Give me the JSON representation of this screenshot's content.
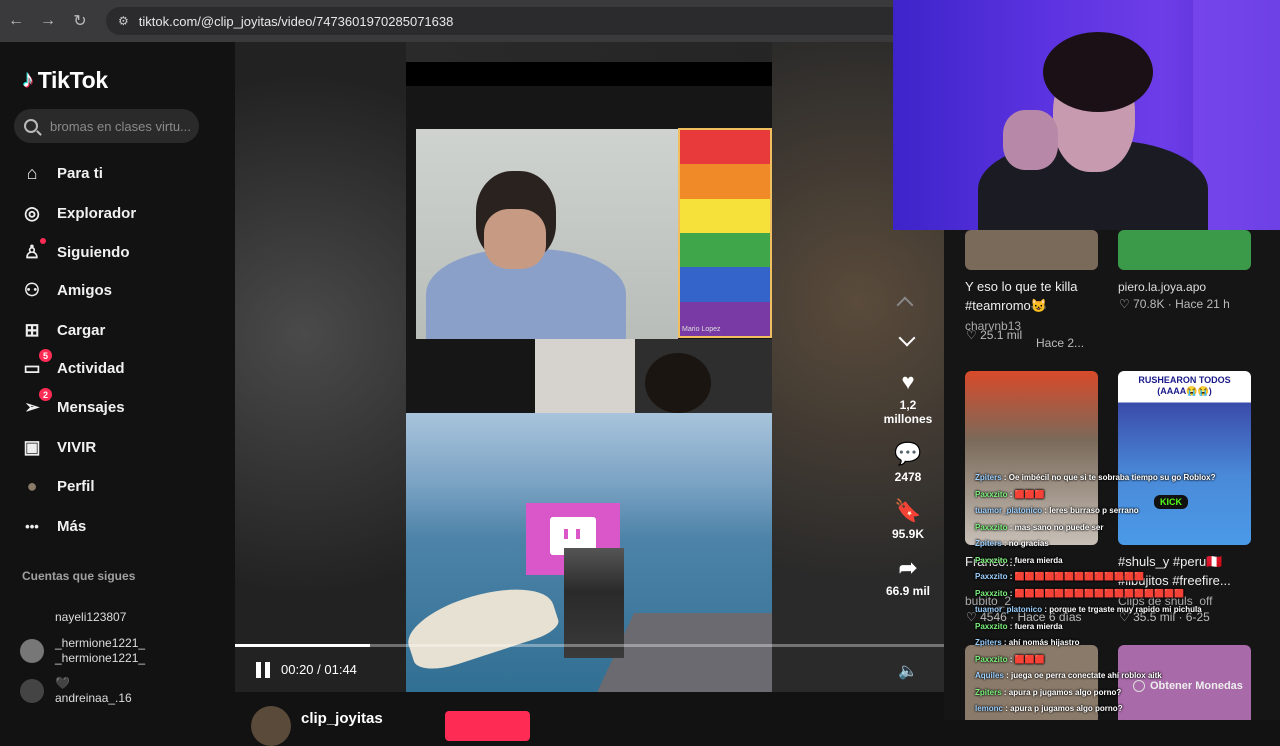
{
  "browser": {
    "url": "tiktok.com/@clip_joyitas/video/7473601970285071638",
    "back_icon": "←",
    "forward_icon": "→",
    "reload_icon": "↻",
    "site_icon": "⚙"
  },
  "sidebar": {
    "logo": "TikTok",
    "search_placeholder": "bromas en clases virtu...",
    "items": [
      {
        "label": "Para ti",
        "icon": "⌂"
      },
      {
        "label": "Explorador",
        "icon": "◎"
      },
      {
        "label": "Siguiendo",
        "icon": "♙"
      },
      {
        "label": "Amigos",
        "icon": "⚇"
      },
      {
        "label": "Cargar",
        "icon": "⊞"
      },
      {
        "label": "Actividad",
        "icon": "▭",
        "badge": "5"
      },
      {
        "label": "Mensajes",
        "icon": "➢",
        "badge": "2"
      },
      {
        "label": "VIVIR",
        "icon": "▣"
      },
      {
        "label": "Perfil",
        "icon": "●"
      },
      {
        "label": "Más",
        "icon": "•••"
      }
    ],
    "following_title": "Cuentas que sigues",
    "accounts": [
      {
        "line1": "nayeli123807",
        "line2": ""
      },
      {
        "line1": "_hermione1221_",
        "line2": "_hermione1221_"
      },
      {
        "line1": "🖤",
        "line2": "andreinaa_.16"
      }
    ]
  },
  "video": {
    "meet_name": "Mario Lopez",
    "time": "00:20 / 01:44",
    "progress": 0.19,
    "likes": "1,2 millones",
    "comments": "2478",
    "saves": "95.9K",
    "shares": "66.9 mil",
    "author": "clip_joyitas",
    "colors": {
      "accent": "#fe2c55"
    }
  },
  "right": {
    "cards": [
      {
        "title": "Y eso lo que te killa #teamromo😺",
        "user": "charvnb13",
        "likes": "25.1 mil",
        "age": "Hace 2..."
      },
      {
        "title": "",
        "user": "piero.la.joya.apo",
        "likes": "70.8K",
        "age": "Hace 21 h"
      },
      {
        "title": "Franco...",
        "user": "bubito_2",
        "likes": "4546",
        "age": "Hace 6 días"
      },
      {
        "title": "#shuls_y #peru🇵🇪 #libujitos #freefire...",
        "user": "Clips de shuls_off",
        "likes": "35.5 mil",
        "age": "6-25"
      }
    ],
    "thumb_text": "RUSHEARON TODOS (AAAA😭😭)",
    "kick_label": "KICK",
    "coins": "Obtener Monedas"
  },
  "chat": [
    {
      "user": "Zpiters",
      "msg": ": Oe imbécil no que si te sobraba tiempo su go Roblox?"
    },
    {
      "user": "Paxxzito",
      "msg": ": 🟥🟥🟥"
    },
    {
      "user": "tuamor_platonico",
      "msg": ": leres burraso p serrano"
    },
    {
      "user": "Paxxzito",
      "msg": ": mas sano no puede ser"
    },
    {
      "user": "Zpiters",
      "msg": ": no gracias"
    },
    {
      "user": "Paxxzito",
      "msg": ": fuera mierda"
    },
    {
      "user": "Paxxzito",
      "msg": ": 🟥🟥🟥🟥🟥🟥🟥🟥🟥🟥🟥🟥🟥"
    },
    {
      "user": "Paxxzito",
      "msg": ": 🟥🟥🟥🟥🟥🟥🟥🟥🟥🟥🟥🟥🟥🟥🟥🟥🟥"
    },
    {
      "user": "tuamor_platonico",
      "msg": ": porque te trgaste muy rapido mi pichula"
    },
    {
      "user": "Paxxzito",
      "msg": ": fuera mierda"
    },
    {
      "user": "Zpiters",
      "msg": ": ahí nomás hijastro"
    },
    {
      "user": "Paxxzito",
      "msg": ": 🟥🟥🟥"
    },
    {
      "user": "Aquiles",
      "msg": ": juega oe perra conectate ahí roblox aitk"
    },
    {
      "user": "Zpiters",
      "msg": ": apura p jugamos algo porno?"
    },
    {
      "user": "lemonc",
      "msg": ": apura p jugamos algo porno?"
    }
  ]
}
